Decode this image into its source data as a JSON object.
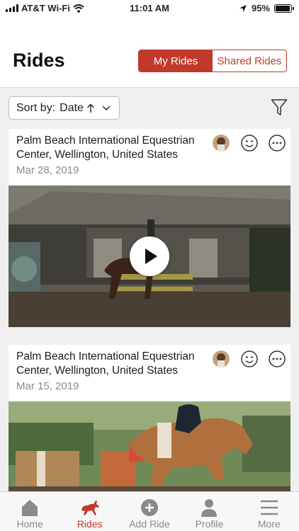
{
  "status_bar": {
    "carrier": "AT&T Wi-Fi",
    "time": "11:01 AM",
    "battery": "95%",
    "battery_level": 0.95
  },
  "header": {
    "title": "Rides",
    "segments": [
      "My Rides",
      "Shared Rides"
    ],
    "active_segment": "My Rides"
  },
  "toolbar": {
    "sort_prefix": "Sort by:",
    "sort_value": "Date",
    "sort_direction_icon": "arrow-up-icon",
    "filter_icon": "funnel-icon"
  },
  "rides": [
    {
      "location": "Palm Beach International Equestrian Center, Wellington, United States",
      "date": "Mar 28, 2019",
      "media": "video"
    },
    {
      "location": "Palm Beach International Equestrian Center, Wellington, United States",
      "date": "Mar 15, 2019",
      "media": "photo"
    }
  ],
  "tabs": [
    {
      "label": "Home",
      "icon": "home-icon"
    },
    {
      "label": "Rides",
      "icon": "horse-icon"
    },
    {
      "label": "Add Ride",
      "icon": "plus-circle-icon"
    },
    {
      "label": "Profile",
      "icon": "person-icon"
    },
    {
      "label": "More",
      "icon": "menu-icon"
    }
  ],
  "active_tab": "Rides",
  "colors": {
    "accent": "#c0392b",
    "inactive_tab": "#8a8a8a",
    "date_text": "#8a8a8a",
    "page_bg": "#efefef"
  }
}
